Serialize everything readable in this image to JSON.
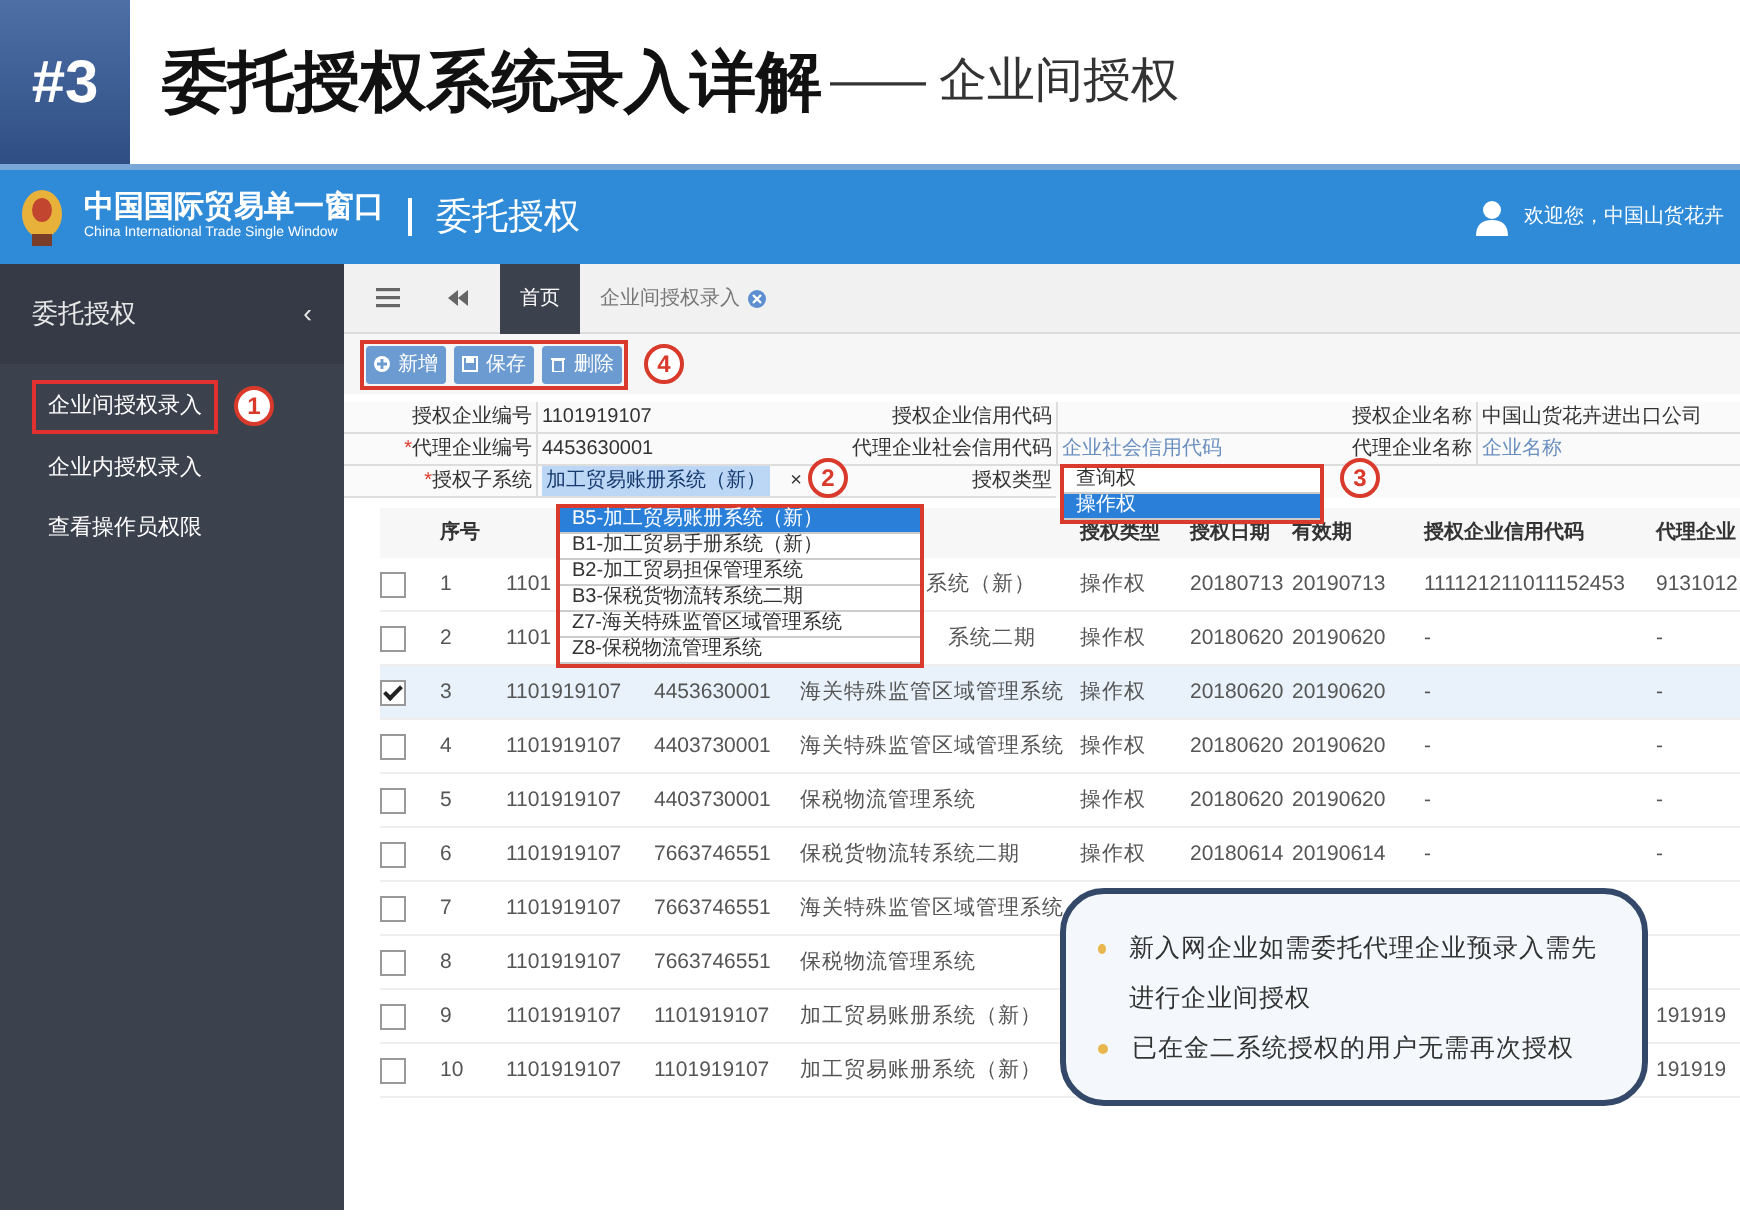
{
  "slide": {
    "number": "#3",
    "title": "委托授权系统录入详解",
    "subtitle": "—— 企业间授权"
  },
  "app": {
    "logo_title": "中国国际贸易单一窗口",
    "logo_subtitle": "China International Trade Single Window",
    "module": "委托授权",
    "welcome": "欢迎您，中国山货花卉"
  },
  "sidebar": {
    "title": "委托授权",
    "collapse": "‹",
    "marker": "1",
    "items": [
      {
        "label": "企业间授权录入",
        "selected": true
      },
      {
        "label": "企业内授权录入",
        "selected": false
      },
      {
        "label": "查看操作员权限",
        "selected": false
      }
    ]
  },
  "tabs": [
    {
      "label": "首页",
      "selected": true,
      "closable": false
    },
    {
      "label": "企业间授权录入",
      "selected": false,
      "closable": true
    }
  ],
  "toolbar": {
    "marker": "4",
    "buttons": [
      {
        "label": "新增",
        "kind": "add"
      },
      {
        "label": "保存",
        "kind": "save"
      },
      {
        "label": "删除",
        "kind": "delete"
      }
    ]
  },
  "form": {
    "fields": [
      {
        "label": "授权企业编号",
        "value": "1101919107"
      },
      {
        "label": "授权企业信用代码"
      },
      {
        "label": "授权企业名称",
        "value": "中国山货花卉进出口公司"
      },
      {
        "label": "代理企业编号",
        "required_mark": "*",
        "value": "4453630001"
      },
      {
        "label": "代理企业社会信用代码",
        "placeholder": "企业社会信用代码"
      },
      {
        "label": "代理企业名称",
        "placeholder": "企业名称"
      },
      {
        "label": "授权子系统",
        "required_mark": "*",
        "value": "加工贸易账册系统（新）",
        "clear": "×",
        "marker": "2"
      },
      {
        "label": "授权类型",
        "marker": "3"
      }
    ]
  },
  "subsystem_dropdown": {
    "options": [
      {
        "label": "B5-加工贸易账册系统（新）",
        "selected": true
      },
      {
        "label": "B1-加工贸易手册系统（新）",
        "selected": false
      },
      {
        "label": "B2-加工贸易担保管理系统",
        "selected": false
      },
      {
        "label": "B3-保税货物流转系统二期",
        "selected": false
      },
      {
        "label": "Z7-海关特殊监管区域管理系统",
        "selected": false
      },
      {
        "label": "Z8-保税物流管理系统",
        "selected": false
      }
    ]
  },
  "type_dropdown": {
    "options": [
      {
        "label": "查询权",
        "selected": false
      },
      {
        "label": "操作权",
        "selected": true
      }
    ]
  },
  "table": {
    "columns": [
      "序号",
      "",
      "",
      "",
      "授权类型",
      "授权日期",
      "有效期",
      "授权企业信用代码",
      "代理企业"
    ],
    "rows": [
      {
        "checked": false,
        "cells": [
          "1",
          "1101",
          null,
          "系统（新）",
          "操作权",
          "20180713",
          "20190713",
          "111121211011152453",
          "9131012"
        ]
      },
      {
        "checked": false,
        "cells": [
          "2",
          "1101",
          null,
          "系统二期",
          "操作权",
          "20180620",
          "20190620",
          "-",
          "-"
        ]
      },
      {
        "checked": true,
        "cells": [
          "3",
          "1101919107",
          "4453630001",
          "海关特殊监管区域管理系统",
          "操作权",
          "20180620",
          "20190620",
          "-",
          "-"
        ]
      },
      {
        "checked": false,
        "cells": [
          "4",
          "1101919107",
          "4403730001",
          "海关特殊监管区域管理系统",
          "操作权",
          "20180620",
          "20190620",
          "-",
          "-"
        ]
      },
      {
        "checked": false,
        "cells": [
          "5",
          "1101919107",
          "4403730001",
          "保税物流管理系统",
          "操作权",
          "20180620",
          "20190620",
          "-",
          "-"
        ]
      },
      {
        "checked": false,
        "cells": [
          "6",
          "1101919107",
          "7663746551",
          "保税货物流转系统二期",
          "操作权",
          "20180614",
          "20190614",
          "-",
          "-"
        ]
      },
      {
        "checked": false,
        "cells": [
          "7",
          "1101919107",
          "7663746551",
          "海关特殊监管区域管理系统",
          null,
          null,
          null,
          null,
          null
        ]
      },
      {
        "checked": false,
        "cells": [
          "8",
          "1101919107",
          "7663746551",
          "保税物流管理系统",
          null,
          null,
          null,
          null,
          null
        ]
      },
      {
        "checked": false,
        "cells": [
          "9",
          "1101919107",
          "1101919107",
          "加工贸易账册系统（新）",
          null,
          null,
          null,
          null,
          "191919"
        ]
      },
      {
        "checked": false,
        "cells": [
          "10",
          "1101919107",
          "1101919107",
          "加工贸易账册系统（新）",
          null,
          null,
          null,
          null,
          "191919"
        ]
      }
    ]
  },
  "callout": {
    "bullets": [
      "新入网企业如需委托代理企业预录入需先进行企业间授权",
      "已在金二系统授权的用户无需再次授权"
    ]
  }
}
